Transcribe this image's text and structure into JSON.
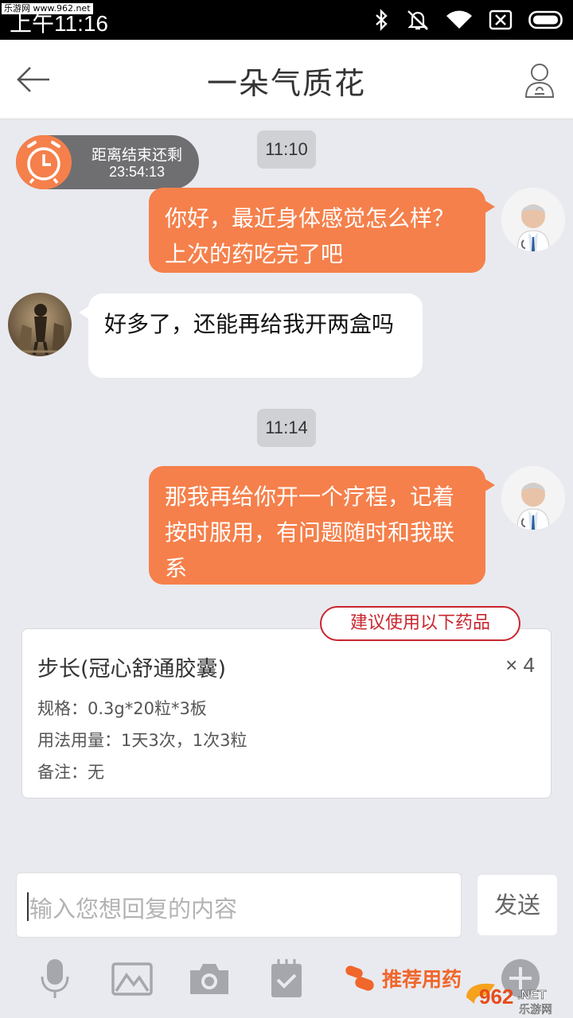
{
  "status_bar": {
    "time": "上午11:16",
    "watermark": "乐游网 www.962.net"
  },
  "header": {
    "title": "一朵气质花",
    "back_icon": "back-arrow-icon",
    "profile_icon": "profile-icon"
  },
  "timer": {
    "label": "距离结束还剩",
    "remaining": "23:54:13"
  },
  "messages": [
    {
      "type": "timestamp",
      "text": "11:10"
    },
    {
      "type": "sent",
      "sender": "doctor",
      "text": "你好，最近身体感觉怎么样？上次的药吃完了吧"
    },
    {
      "type": "received",
      "sender": "patient",
      "text": "好多了，还能再给我开两盒吗"
    },
    {
      "type": "timestamp",
      "text": "11:14"
    },
    {
      "type": "sent",
      "sender": "doctor",
      "text": "那我再给你开一个疗程，记着按时服用，有问题随时和我联系"
    }
  ],
  "prescription": {
    "tag": "建议使用以下药品",
    "name": "步长(冠心舒通胶囊)",
    "quantity": "× 4",
    "spec": "规格：0.3g*20粒*3板",
    "usage": "用法用量：1天3次，1次3粒",
    "note": "备注：无"
  },
  "composer": {
    "placeholder": "输入您想回复的内容",
    "send_label": "发送"
  },
  "toolbar": {
    "items": [
      "microphone-icon",
      "image-icon",
      "camera-icon",
      "calendar-check-icon",
      "pill-icon",
      "plus-icon"
    ],
    "recommend_label": "推荐用药"
  },
  "watermark_logo": {
    "text": "962",
    "suffix": ".NET",
    "sub": "乐游网"
  },
  "colors": {
    "accent": "#f5804b",
    "tag_red": "#c9262f",
    "timer_bg": "#6f6f72",
    "chat_bg": "#e9eaef"
  }
}
